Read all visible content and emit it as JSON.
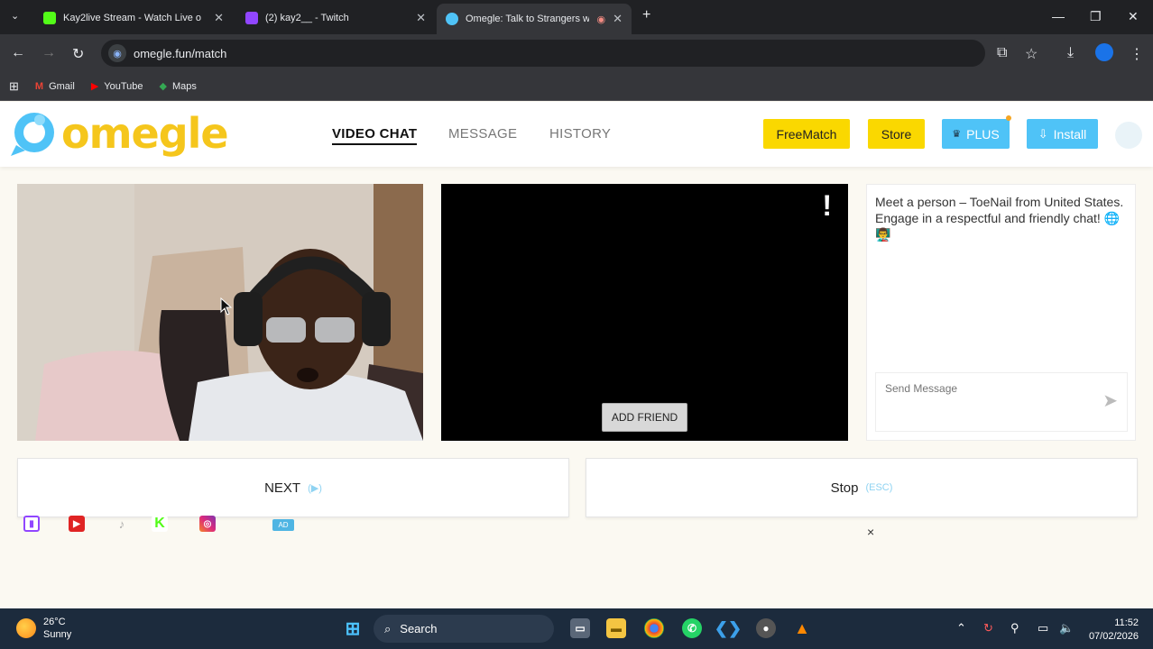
{
  "browser": {
    "tabs": [
      {
        "title": "Kay2live Stream - Watch Live o",
        "favicon_color": "#53fc18",
        "active": false
      },
      {
        "title": "(2) kay2__ - Twitch",
        "favicon_color": "#9146ff",
        "active": false
      },
      {
        "title": "Omegle: Talk to Strangers w",
        "favicon_color": "#4fc3f7",
        "active": true
      }
    ],
    "url": "omegle.fun/match",
    "bookmarks": [
      {
        "label": "Gmail",
        "icon": "gmail-icon"
      },
      {
        "label": "YouTube",
        "icon": "youtube-icon"
      },
      {
        "label": "Maps",
        "icon": "maps-icon"
      }
    ]
  },
  "site": {
    "logo_text": "omegle",
    "nav": [
      {
        "label": "VIDEO CHAT",
        "active": true
      },
      {
        "label": "MESSAGE",
        "active": false
      },
      {
        "label": "HISTORY",
        "active": false
      }
    ],
    "buttons": {
      "freematch": "FreeMatch",
      "store": "Store",
      "plus": "PLUS",
      "install": "Install"
    },
    "colors": {
      "logo_yellow": "#f5c61c",
      "button_yellow": "#fad800",
      "button_blue": "#4fc3f7"
    }
  },
  "video": {
    "report_glyph": "!",
    "add_friend": "ADD FRIEND"
  },
  "chat": {
    "message": "Meet a person – ToeNail from United States. Engage in a respectful and friendly chat! 🌐 👨‍🏫",
    "input_placeholder": "Send Message"
  },
  "controls": {
    "next_label": "NEXT",
    "next_hint": "(▶)",
    "stop_label": "Stop",
    "stop_hint": "(ESC)"
  },
  "ad": {
    "badge": "AD",
    "close": "×",
    "socials": [
      "twitch-icon",
      "youtube-icon",
      "tiktok-icon",
      "kick-icon",
      "instagram-icon"
    ]
  },
  "taskbar": {
    "temperature": "26°C",
    "condition": "Sunny",
    "search_label": "Search",
    "time": "11:52",
    "date": "07/02/2026"
  }
}
